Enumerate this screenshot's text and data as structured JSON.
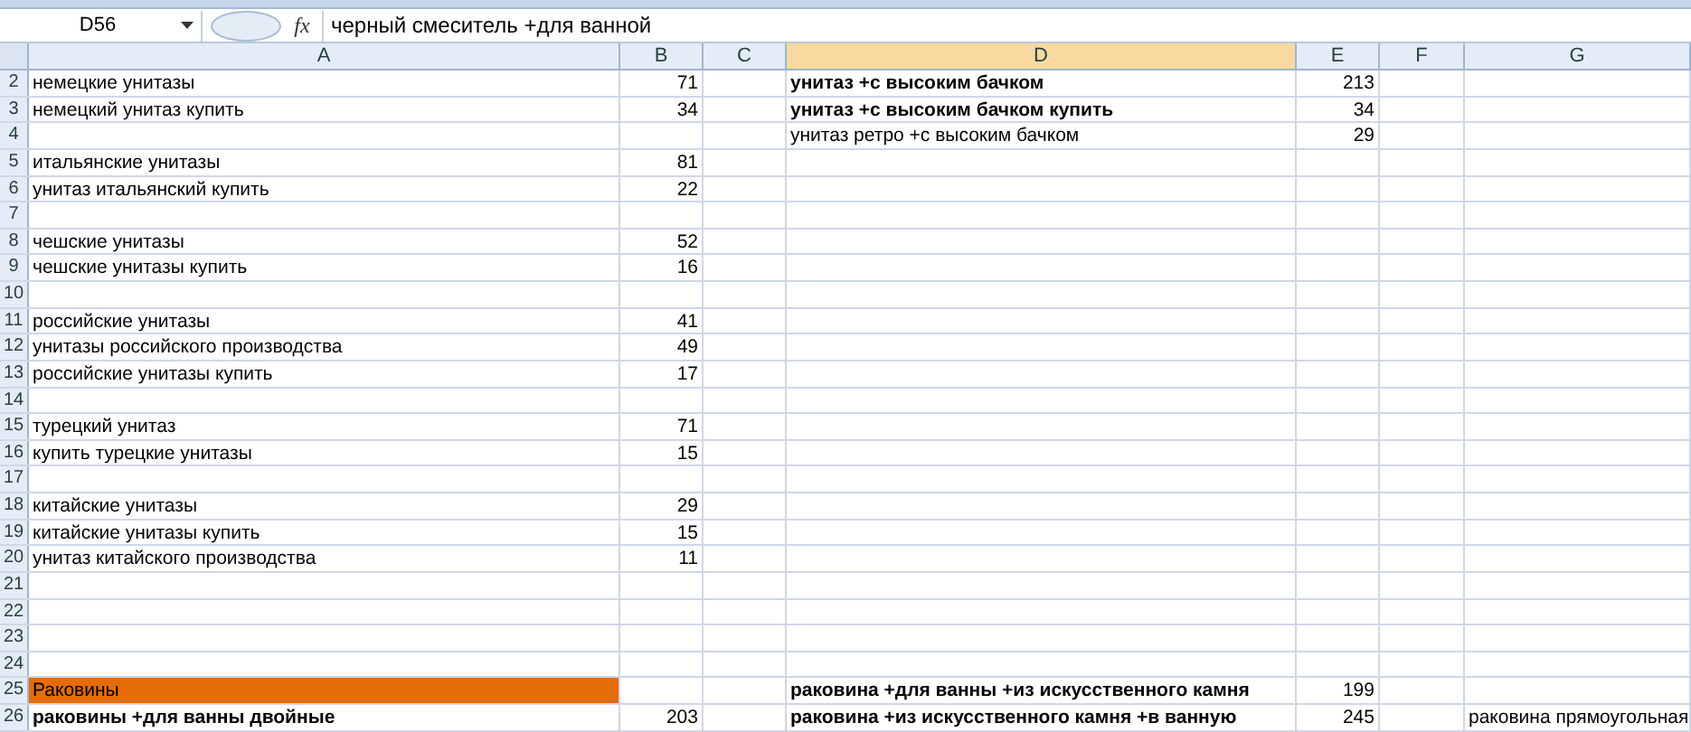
{
  "formula_bar": {
    "name_box": "D56",
    "function_label": "fx",
    "formula": "черный смеситель +для ванной"
  },
  "columns": [
    {
      "label": "A",
      "selected": false
    },
    {
      "label": "B",
      "selected": false
    },
    {
      "label": "C",
      "selected": false
    },
    {
      "label": "D",
      "selected": true
    },
    {
      "label": "E",
      "selected": false
    },
    {
      "label": "F",
      "selected": false
    },
    {
      "label": "G",
      "selected": false
    }
  ],
  "rows": [
    {
      "number": "2",
      "a": {
        "text": "немецкие унитазы",
        "bold": false
      },
      "b": {
        "text": "71",
        "bold": false
      },
      "d": {
        "text": "унитаз +с высоким бачком",
        "bold": true
      },
      "e": {
        "text": "213",
        "bold": false
      }
    },
    {
      "number": "3",
      "a": {
        "text": "немецкий унитаз купить",
        "bold": false
      },
      "b": {
        "text": "34",
        "bold": false
      },
      "d": {
        "text": "унитаз +с высоким бачком купить",
        "bold": true
      },
      "e": {
        "text": "34",
        "bold": false
      }
    },
    {
      "number": "4",
      "d": {
        "text": "унитаз ретро +с высоким бачком",
        "bold": false
      },
      "e": {
        "text": "29",
        "bold": false
      }
    },
    {
      "number": "5",
      "a": {
        "text": "итальянские унитазы",
        "bold": false
      },
      "b": {
        "text": "81",
        "bold": false
      }
    },
    {
      "number": "6",
      "a": {
        "text": "унитаз итальянский купить",
        "bold": false
      },
      "b": {
        "text": "22",
        "bold": false
      }
    },
    {
      "number": "7"
    },
    {
      "number": "8",
      "a": {
        "text": "чешские унитазы",
        "bold": false
      },
      "b": {
        "text": "52",
        "bold": false
      }
    },
    {
      "number": "9",
      "a": {
        "text": "чешские унитазы купить",
        "bold": false
      },
      "b": {
        "text": "16",
        "bold": false
      }
    },
    {
      "number": "10"
    },
    {
      "number": "11",
      "a": {
        "text": "российские унитазы",
        "bold": false
      },
      "b": {
        "text": "41",
        "bold": false
      }
    },
    {
      "number": "12",
      "a": {
        "text": "унитазы российского производства",
        "bold": false
      },
      "b": {
        "text": "49",
        "bold": false
      }
    },
    {
      "number": "13",
      "a": {
        "text": "российские унитазы купить",
        "bold": false
      },
      "b": {
        "text": "17",
        "bold": false
      }
    },
    {
      "number": "14"
    },
    {
      "number": "15",
      "a": {
        "text": "турецкий унитаз",
        "bold": false
      },
      "b": {
        "text": "71",
        "bold": false
      }
    },
    {
      "number": "16",
      "a": {
        "text": "купить турецкие унитазы",
        "bold": false
      },
      "b": {
        "text": "15",
        "bold": false
      }
    },
    {
      "number": "17"
    },
    {
      "number": "18",
      "a": {
        "text": "китайские унитазы",
        "bold": false
      },
      "b": {
        "text": "29",
        "bold": false
      }
    },
    {
      "number": "19",
      "a": {
        "text": "китайские унитазы купить",
        "bold": false
      },
      "b": {
        "text": "15",
        "bold": false
      }
    },
    {
      "number": "20",
      "a": {
        "text": "унитаз китайского производства",
        "bold": false
      },
      "b": {
        "text": "11",
        "bold": false
      }
    },
    {
      "number": "21"
    },
    {
      "number": "22"
    },
    {
      "number": "23"
    },
    {
      "number": "24"
    },
    {
      "number": "25",
      "a": {
        "text": "Раковины",
        "bold": false,
        "color": "#e46c0a"
      },
      "d": {
        "text": "раковина +для ванны +из искусственного камня",
        "bold": true
      },
      "e": {
        "text": "199",
        "bold": false
      }
    },
    {
      "number": "26",
      "a": {
        "text": "раковины +для ванны двойные",
        "bold": true
      },
      "b": {
        "text": "203",
        "bold": false
      },
      "d": {
        "text": "раковина +из искусственного камня +в ванную",
        "bold": true
      },
      "e": {
        "text": "245",
        "bold": false
      },
      "g": {
        "text": "раковина прямоугольная",
        "bold": false
      }
    }
  ]
}
